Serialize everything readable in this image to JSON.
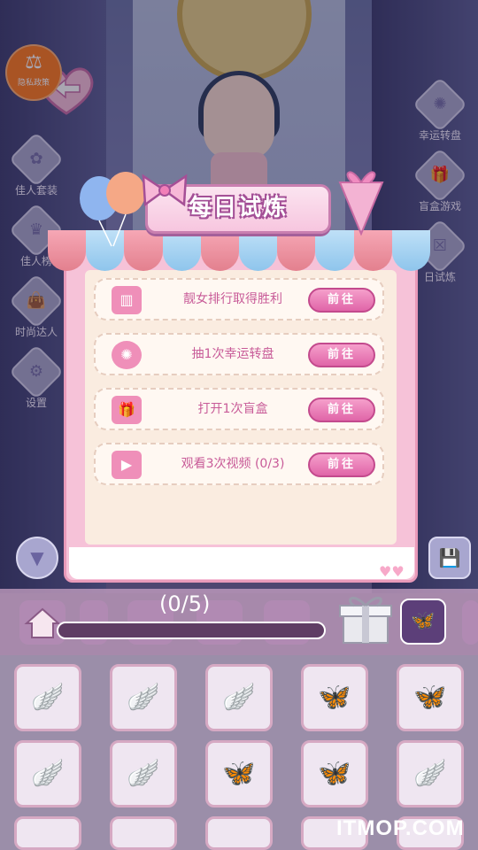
{
  "privacy": {
    "label": "隐私政策"
  },
  "left_menu": [
    {
      "label": "佳人套装"
    },
    {
      "label": "佳人榜"
    },
    {
      "label": "时尚达人"
    },
    {
      "label": "设置"
    }
  ],
  "right_menu": [
    {
      "label": "幸运转盘"
    },
    {
      "label": "盲盒游戏"
    },
    {
      "label": "日试炼"
    }
  ],
  "modal": {
    "title": "每日试炼",
    "tasks": [
      {
        "icon": "podium-icon",
        "label": "靓女排行取得胜利",
        "button": "前往"
      },
      {
        "icon": "wheel-icon",
        "label": "抽1次幸运转盘",
        "button": "前往"
      },
      {
        "icon": "gift-icon",
        "label": "打开1次盲盒",
        "button": "前往"
      },
      {
        "icon": "video-icon",
        "label": "观看3次视频 (0/3)",
        "button": "前往"
      }
    ]
  },
  "progress": {
    "label": "(0/5)",
    "current": 0,
    "total": 5
  },
  "watermark": "ITMOP.COM",
  "colors": {
    "accent": "#e065a8",
    "modal_bg": "#f6c2d8",
    "text_pink": "#c85b98"
  }
}
